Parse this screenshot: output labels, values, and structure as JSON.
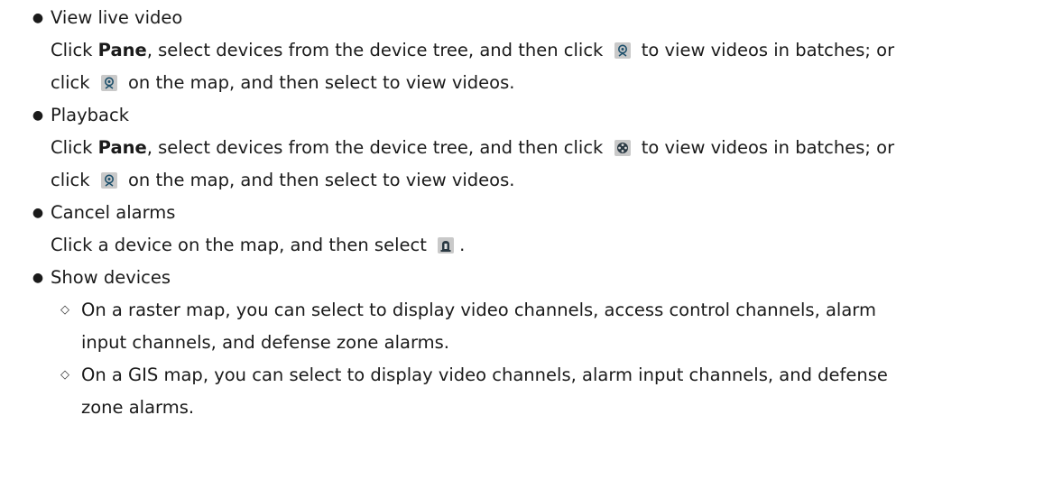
{
  "items": [
    {
      "title": "View live video",
      "lines": [
        {
          "p1": "Click ",
          "bold": "Pane",
          "p2": ", select devices from the device tree, and then click ",
          "icon": "video-camera-icon",
          "p3": " to view videos in batches; or"
        },
        {
          "p1": "click ",
          "icon": "video-camera-icon",
          "p2": " on the map, and then select to view videos."
        }
      ]
    },
    {
      "title": "Playback",
      "lines": [
        {
          "p1": "Click ",
          "bold": "Pane",
          "p2": ", select devices from the device tree, and then click ",
          "icon": "playback-film-icon",
          "p3": " to view videos in batches; or"
        },
        {
          "p1": "click ",
          "icon": "video-camera-icon",
          "p2": " on the map, and then select to view videos."
        }
      ]
    },
    {
      "title": "Cancel alarms",
      "lines": [
        {
          "p1": "Click a device on the map, and then select ",
          "icon": "alarm-light-icon",
          "p2": "."
        }
      ]
    },
    {
      "title": "Show devices",
      "subitems": [
        {
          "l1": "On a raster map, you can select to display video channels, access control channels, alarm",
          "l2": "input channels, and defense zone alarms."
        },
        {
          "l1": "On a GIS map, you can select to display video channels, alarm input channels, and defense",
          "l2": "zone alarms."
        }
      ]
    }
  ]
}
